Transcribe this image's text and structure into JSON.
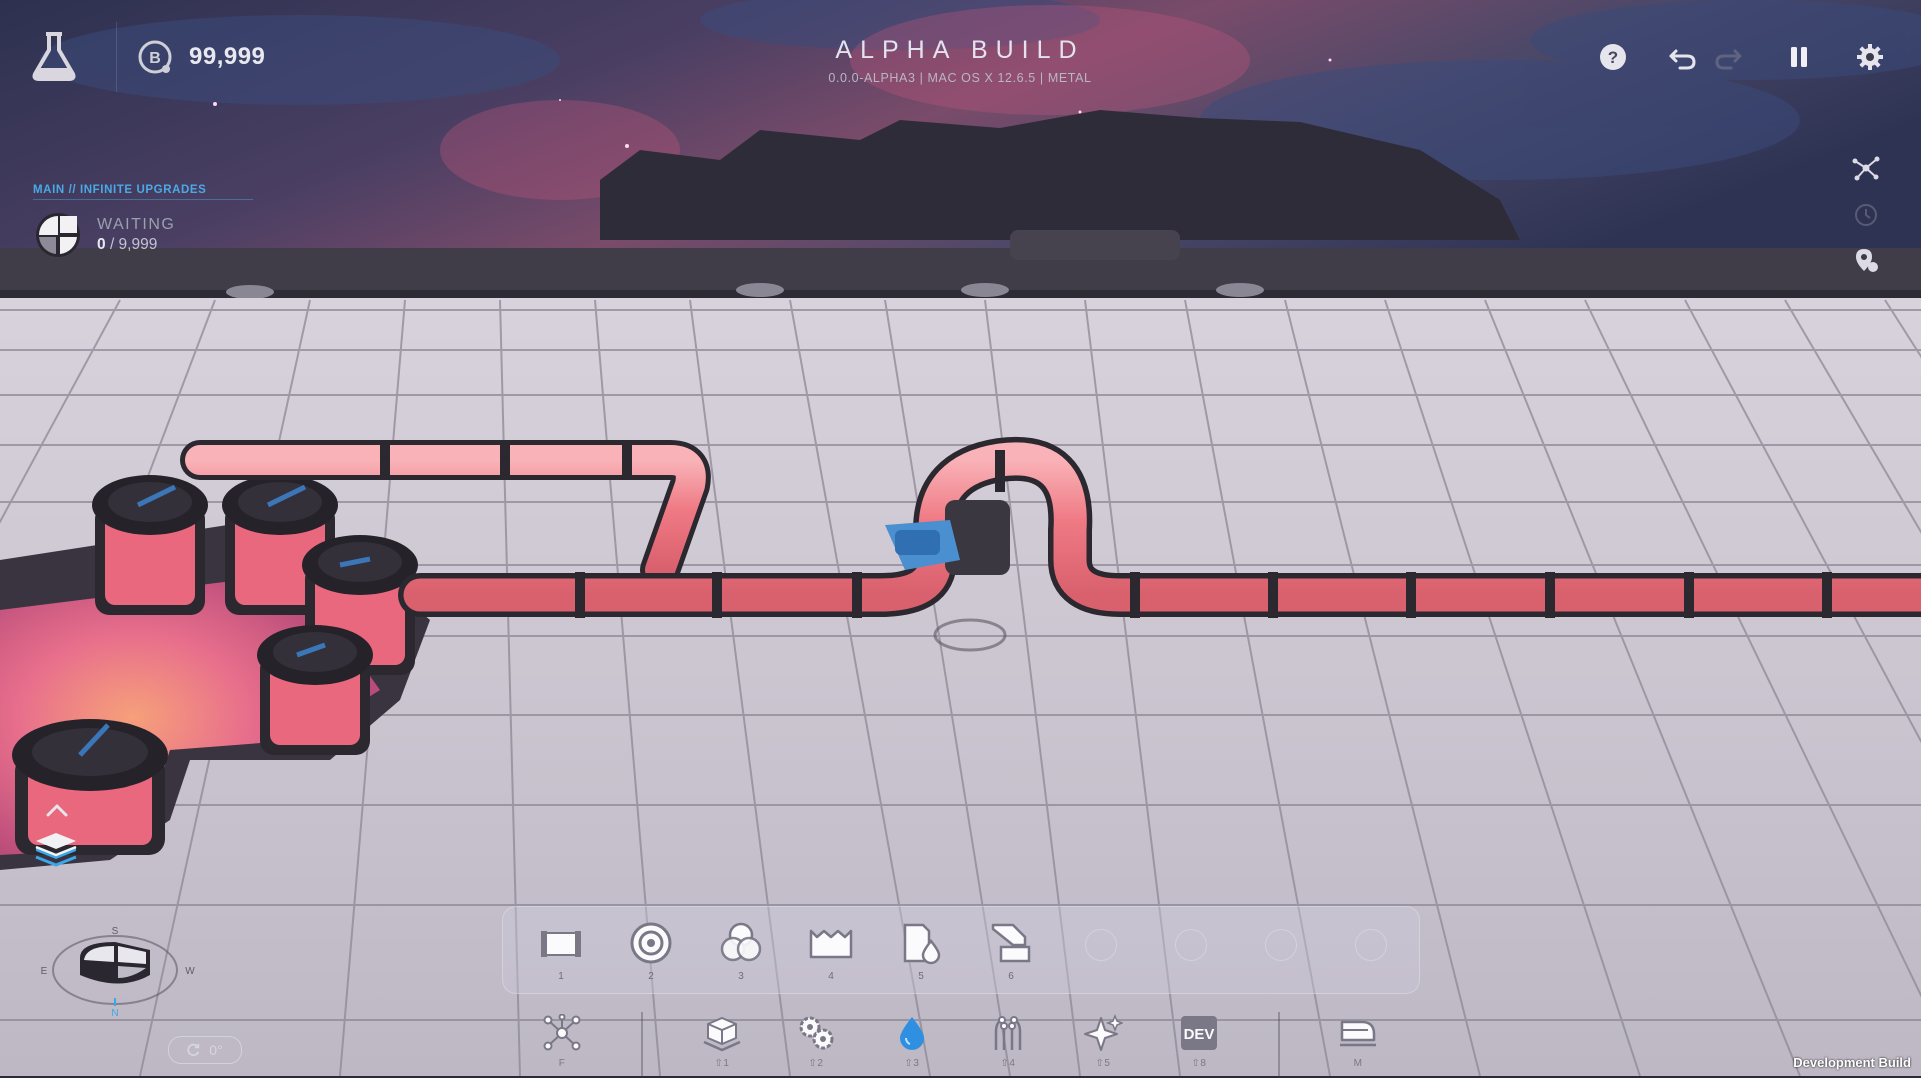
{
  "hud": {
    "currency_amount": "99,999",
    "title": "ALPHA BUILD",
    "build_info": "0.0.0-ALPHA3 | MAC OS X 12.6.5 | METAL"
  },
  "tracker": {
    "header": "MAIN // INFINITE UPGRADES",
    "status": "WAITING",
    "progress_current": "0",
    "progress_total": "/ 9,999"
  },
  "top_icons": [
    "help-icon",
    "undo-icon",
    "redo-icon",
    "pause-icon",
    "settings-icon"
  ],
  "side_icons": [
    "network-icon",
    "history-icon",
    "map-marker-icon"
  ],
  "toolbar": {
    "slots": [
      {
        "key": "1",
        "icon": "foundation-icon"
      },
      {
        "key": "2",
        "icon": "extractor-icon"
      },
      {
        "key": "3",
        "icon": "mixer-icon"
      },
      {
        "key": "4",
        "icon": "fluid-tank-icon"
      },
      {
        "key": "5",
        "icon": "fluid-canister-icon"
      },
      {
        "key": "6",
        "icon": "pump-icon"
      }
    ]
  },
  "categories": [
    {
      "key": "F",
      "icon": "network-icon"
    },
    {
      "key": "⇧1",
      "icon": "belts-icon"
    },
    {
      "key": "⇧2",
      "icon": "processing-icon"
    },
    {
      "key": "⇧3",
      "icon": "fluids-icon",
      "active": true
    },
    {
      "key": "⇧4",
      "icon": "wires-icon"
    },
    {
      "key": "⇧5",
      "icon": "effects-icon"
    },
    {
      "key": "⇧8",
      "icon": "dev-icon",
      "label": "DEV"
    },
    {
      "key": "M",
      "icon": "train-icon"
    }
  ],
  "rotation": "0°",
  "compass": {
    "s": "S",
    "e": "E",
    "w": "W",
    "n": "N"
  },
  "dev_build_label": "Development Build",
  "colors": {
    "accent_blue": "#4aa9e6",
    "pipe_fluid": "#f07d86",
    "floor": "#c9c4cf"
  }
}
